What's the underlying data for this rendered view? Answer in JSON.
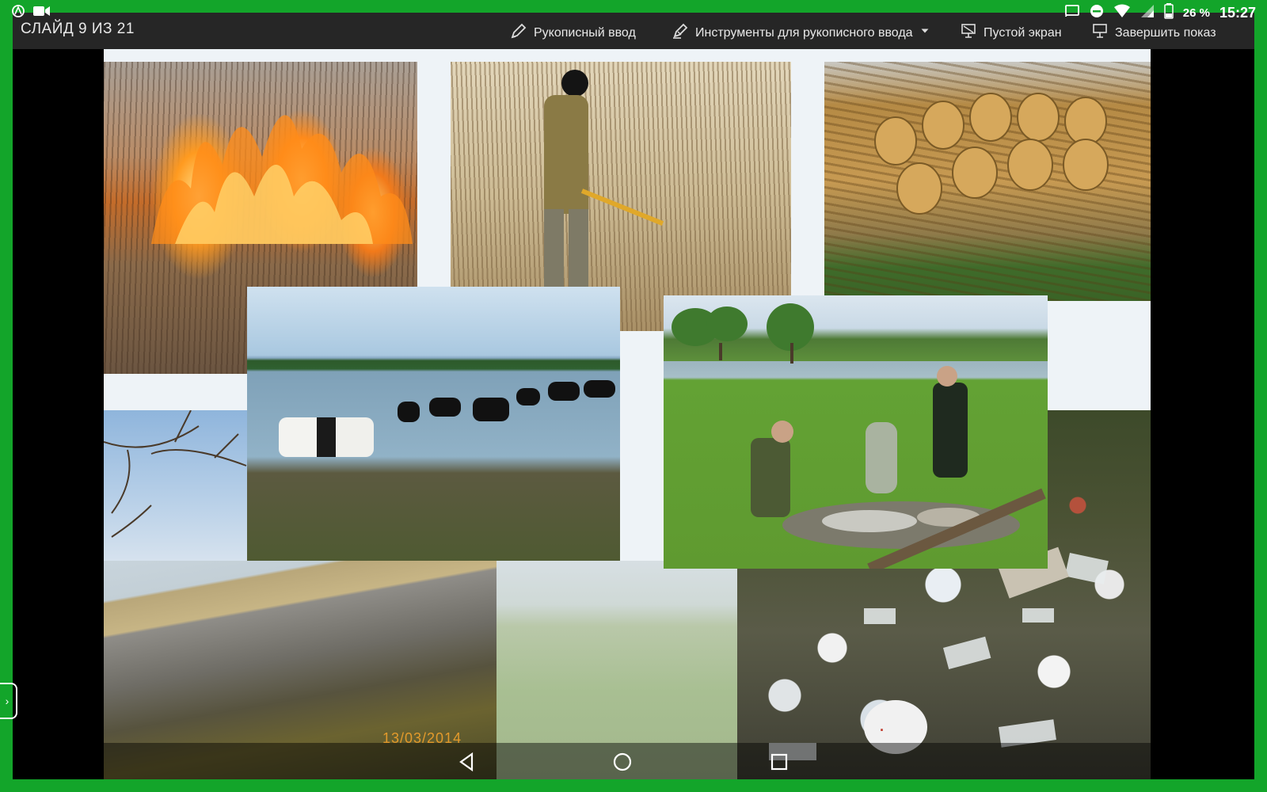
{
  "status_bar": {
    "battery_percent": "26 %",
    "clock": "15:27",
    "icons": [
      "app-icon",
      "camera-icon",
      "cast-icon",
      "do-not-disturb-icon",
      "wifi-icon",
      "signal-icon",
      "battery-icon"
    ]
  },
  "toolbar": {
    "slide_counter": "СЛАЙД 9 ИЗ 21",
    "ink_label": "Рукописный ввод",
    "ink_tools_label": "Инструменты для рукописного ввода",
    "blank_screen_label": "Пустой экран",
    "end_show_label": "Завершить показ"
  },
  "slide": {
    "photo_date_stamp": "13/03/2014"
  },
  "nav_bar": {
    "buttons": [
      "back-icon",
      "home-icon",
      "recents-icon"
    ]
  },
  "colors": {
    "frame_green": "#13a52a",
    "toolbar_bg": "#262626",
    "date_stamp": "#e39a2b"
  }
}
